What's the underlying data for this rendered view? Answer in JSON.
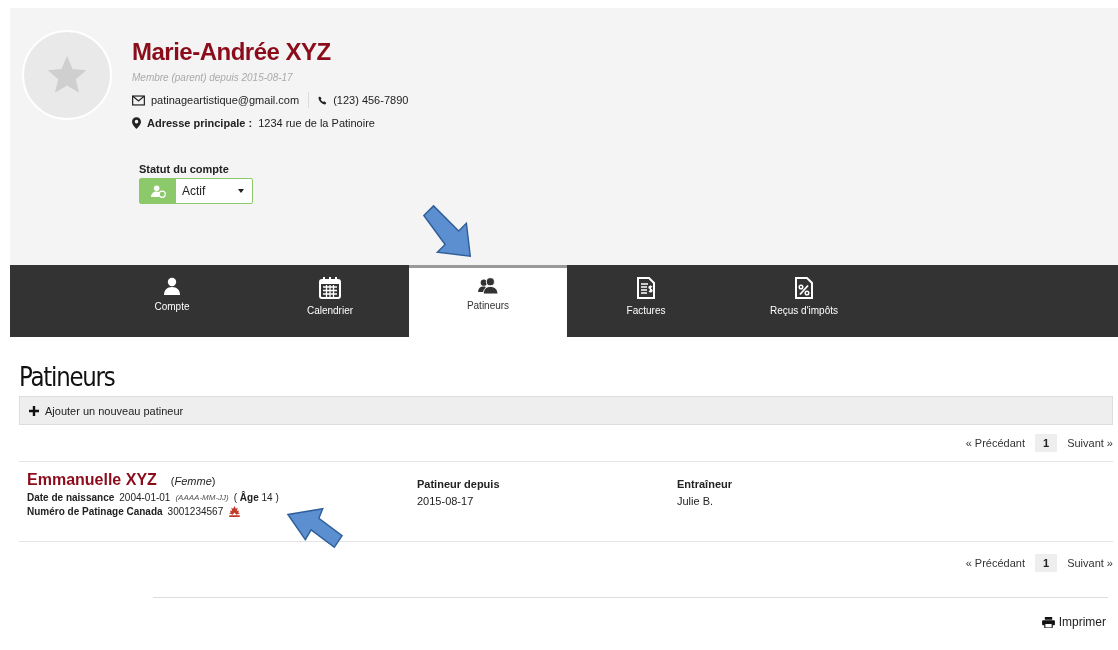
{
  "profile": {
    "name": "Marie-Andrée XYZ",
    "member_since": "Membre (parent) depuis 2015-08-17",
    "email": "patinageartistique@gmail.com",
    "phone": "(123) 456-7890",
    "address_label": "Adresse principale :",
    "address": "1234 rue de la Patinoire",
    "status_label": "Statut du compte",
    "status": "Actif"
  },
  "tabs": [
    {
      "label": "Compte",
      "selected": false
    },
    {
      "label": "Calendrier",
      "selected": false
    },
    {
      "label": "Patineurs",
      "selected": true
    },
    {
      "label": "Factures",
      "selected": false
    },
    {
      "label": "Reçus d'impôts",
      "selected": false
    }
  ],
  "page_title": "Patineurs",
  "add_button": "Ajouter un nouveau patineur",
  "pagination_top": {
    "previous": "« Précédant",
    "pages": [
      {
        "label": "1",
        "selected": true
      }
    ],
    "next": "Suivant »"
  },
  "skaters": [
    {
      "name": "Emmanuelle XYZ",
      "gender": "(*Femme*)",
      "birth_label": "Date de naissance",
      "birth_date": "2004-01-01",
      "date_format": "(AAAA-MM-JJ)",
      "age": "( **Âge** 14 )",
      "number_label": "Numéro de Patinage Canada",
      "number": "3001234567",
      "since_label": "Patineur depuis",
      "since": "2015-08-17",
      "coach_label": "Entraîneur",
      "coach": "Julie B."
    }
  ],
  "pagination_bottom": {
    "previous": "« Précédant",
    "pages": [
      {
        "label": "1",
        "selected": true
      }
    ],
    "next": "Suivant »"
  },
  "print_button": "Imprimer"
}
